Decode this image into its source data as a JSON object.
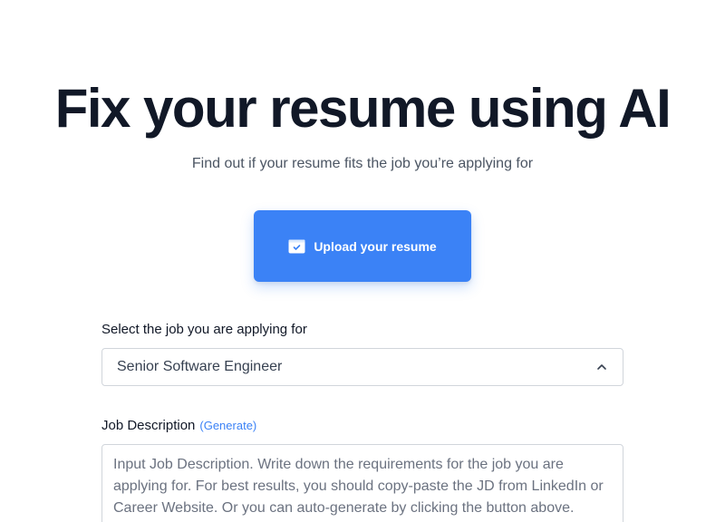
{
  "hero": {
    "title": "Fix your resume using AI",
    "subtitle": "Find out if your resume fits the job you’re applying for"
  },
  "upload": {
    "label": "Upload your resume",
    "icon": "resume-upload-icon"
  },
  "job_select": {
    "label": "Select the job you are applying for",
    "selected": "Senior Software Engineer",
    "icon": "chevron-up-icon"
  },
  "job_description": {
    "label": "Job Description",
    "generate_link": "(Generate)",
    "placeholder": "Input Job Description. Write down the requirements for the job you are applying for. For best results, you should copy-paste the JD from LinkedIn or Career Website. Or you can auto-generate by clicking the button above."
  },
  "colors": {
    "accent": "#3b82f6",
    "title": "#111827",
    "subtitle": "#4b5563",
    "border": "#d1d5db"
  }
}
